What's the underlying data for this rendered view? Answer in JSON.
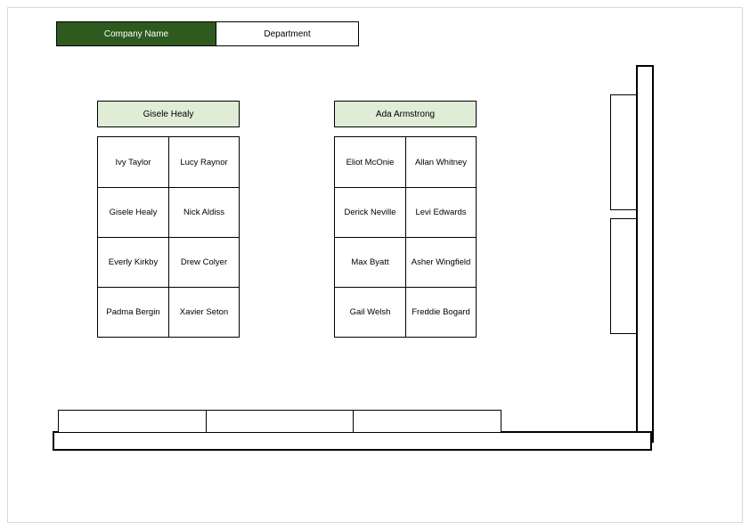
{
  "header": {
    "company_label": "Company Name",
    "department_label": "Department"
  },
  "groups": [
    {
      "header": "Gisele Healy",
      "rows": [
        [
          "Ivy Taylor",
          "Lucy Raynor"
        ],
        [
          "Gisele Healy",
          "Nick Aldiss"
        ],
        [
          "Everly Kirkby",
          "Drew Colyer"
        ],
        [
          "Padma Bergin",
          "Xavier Seton"
        ]
      ]
    },
    {
      "header": "Ada Armstrong",
      "rows": [
        [
          "Eliot McOnie",
          "Allan Whitney"
        ],
        [
          "Derick Neville",
          "Levi Edwards"
        ],
        [
          "Max Byatt",
          "Asher Wingfield"
        ],
        [
          "Gail Welsh",
          "Freddie Bogard"
        ]
      ]
    }
  ]
}
